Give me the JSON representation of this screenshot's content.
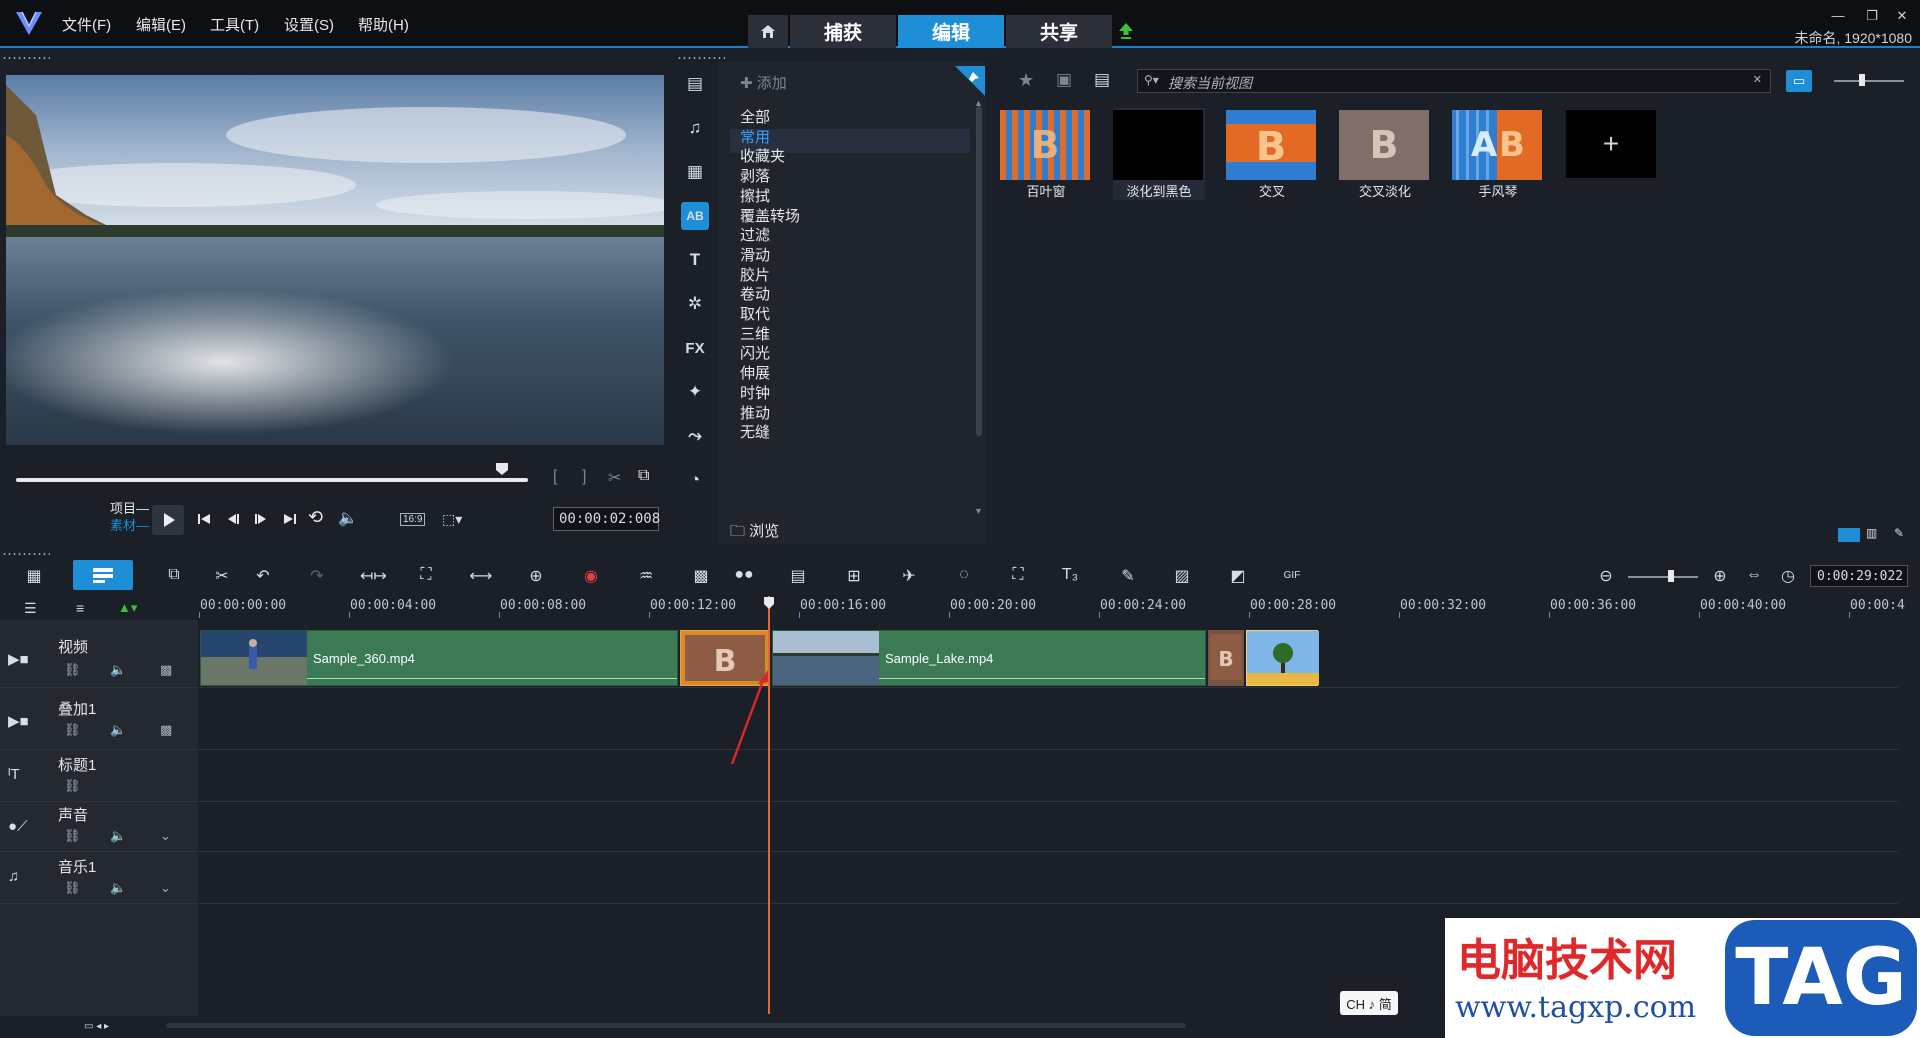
{
  "menu": [
    "文件(F)",
    "编辑(E)",
    "工具(T)",
    "设置(S)",
    "帮助(H)"
  ],
  "nav_tabs": {
    "capture": "捕获",
    "edit": "编辑",
    "share": "共享"
  },
  "project_info": "未命名, 1920*1080",
  "player": {
    "mode_project": "项目",
    "mode_clip": "素材",
    "timecode": "00:00:02:008",
    "aspect": "16:9",
    "scrub_progress": 0.95
  },
  "library": {
    "add_label": "添加",
    "categories": [
      "全部",
      "常用",
      "收藏夹",
      "剥落",
      "擦拭",
      "覆盖转场",
      "过滤",
      "滑动",
      "胶片",
      "卷动",
      "取代",
      "三维",
      "闪光",
      "伸展",
      "时钟",
      "推动",
      "无缝"
    ],
    "selected_category": "常用",
    "browse_label": "浏览",
    "search_placeholder": "搜索当前视图",
    "thumbnails": [
      {
        "caption": "百叶窗",
        "icon": "blinds-transition-icon"
      },
      {
        "caption": "淡化到黑色",
        "icon": "fade-to-black-icon"
      },
      {
        "caption": "交叉",
        "icon": "cross-transition-icon"
      },
      {
        "caption": "交叉淡化",
        "icon": "crossfade-transition-icon"
      },
      {
        "caption": "手风琴",
        "icon": "accordion-transition-icon"
      }
    ],
    "add_thumb": "+"
  },
  "timeline": {
    "timecode": "0:00:29:022",
    "ruler": [
      "00:00:00:00",
      "00:00:04:00",
      "00:00:08:00",
      "00:00:12:00",
      "00:00:16:00",
      "00:00:20:00",
      "00:00:24:00",
      "00:00:28:00",
      "00:00:32:00",
      "00:00:36:00",
      "00:00:40:00",
      "00:00:4"
    ],
    "tracks": [
      {
        "name": "视频"
      },
      {
        "name": "叠加1"
      },
      {
        "name": "标题1"
      },
      {
        "name": "声音"
      },
      {
        "name": "音乐1"
      }
    ],
    "clips": {
      "clip1": "Sample_360.mp4",
      "clip2": "Sample_Lake.mp4"
    }
  },
  "ime": "CH ♪ 简",
  "watermark": {
    "title": "电脑技术网",
    "url": "www.tagxp.com",
    "tag": "TAG"
  },
  "colors": {
    "accent": "#1e8fd7",
    "clip_green": "#3b7a55",
    "playhead": "#e4682c"
  }
}
